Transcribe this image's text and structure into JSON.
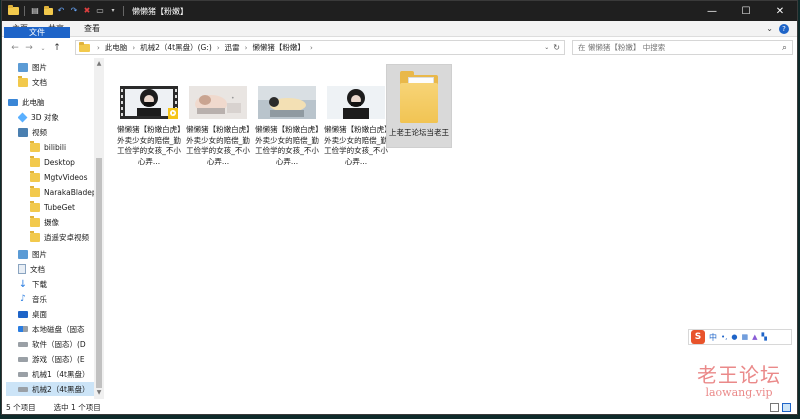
{
  "window": {
    "title": "懒懒猪【粉嫩】",
    "controls": {
      "minimize": "—",
      "maximize": "☐",
      "close": "✕"
    }
  },
  "ribbon": {
    "tabs": [
      "文件",
      "主页",
      "共享",
      "查看"
    ],
    "expand_icon": "chevron-down-icon",
    "help": "?"
  },
  "address": {
    "breadcrumbs": [
      "此电脑",
      "机械2（4t黑盘）(G:)",
      "迅雷",
      "懒懒猪【粉嫩】"
    ],
    "refresh": "↻"
  },
  "search": {
    "placeholder": "在 懒懒猪【粉嫩】 中搜索"
  },
  "nav": {
    "items": [
      {
        "label": "图片",
        "icon": "pictures-icon"
      },
      {
        "label": "文档",
        "icon": "folder-icon"
      },
      {
        "label": "此电脑",
        "icon": "pc-icon"
      },
      {
        "label": "3D 对象",
        "icon": "3d-objects-icon"
      },
      {
        "label": "视频",
        "icon": "videos-icon"
      },
      {
        "label": "bilibili",
        "icon": "folder-icon"
      },
      {
        "label": "Desktop",
        "icon": "folder-icon"
      },
      {
        "label": "MgtvVideos",
        "icon": "folder-icon"
      },
      {
        "label": "NarakaBladep",
        "icon": "folder-icon"
      },
      {
        "label": "TubeGet",
        "icon": "folder-icon"
      },
      {
        "label": "摄像",
        "icon": "folder-icon"
      },
      {
        "label": "逍遥安卓视频",
        "icon": "folder-icon"
      },
      {
        "label": "图片",
        "icon": "pictures-icon"
      },
      {
        "label": "文档",
        "icon": "documents-icon"
      },
      {
        "label": "下载",
        "icon": "download-icon"
      },
      {
        "label": "音乐",
        "icon": "music-icon"
      },
      {
        "label": "桌面",
        "icon": "desktop-icon"
      },
      {
        "label": "本地磁盘（固态",
        "icon": "system-drive-icon"
      },
      {
        "label": "软件（固态）(D",
        "icon": "drive-icon"
      },
      {
        "label": "游戏（固态）(E",
        "icon": "drive-icon"
      },
      {
        "label": "机械1（4t黑盘）",
        "icon": "drive-icon"
      },
      {
        "label": "机械2（4t黑盘）",
        "icon": "drive-icon"
      }
    ]
  },
  "files": [
    {
      "name": "懒懒猪【粉嫩白虎】外卖少女的赔偿_勤工俭学的女孩_不小心弄...",
      "type": "video"
    },
    {
      "name": "懒懒猪【粉嫩白虎】外卖少女的赔偿_勤工俭学的女孩_不小心弄...",
      "type": "video"
    },
    {
      "name": "懒懒猪【粉嫩白虎】外卖少女的赔偿_勤工俭学的女孩_不小心弄...",
      "type": "video"
    },
    {
      "name": "懒懒猪【粉嫩白虎】外卖少女的赔偿_勤工俭学的女孩_不小心弄...",
      "type": "video"
    },
    {
      "name": "上老王论坛当老王",
      "type": "folder"
    }
  ],
  "status": {
    "count": "5 个项目",
    "selected": "选中 1 个项目"
  },
  "ime": {
    "logo": "S",
    "lang": "中",
    "punct": "•,",
    "icons": [
      "mic-icon",
      "keyboard-icon",
      "skin-icon",
      "grid-icon"
    ]
  },
  "watermark": {
    "cn": "老王论坛",
    "url": "laowang.vip"
  }
}
